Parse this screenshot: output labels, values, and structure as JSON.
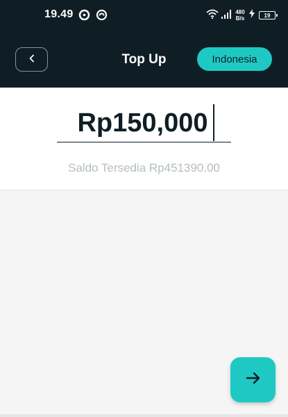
{
  "status_bar": {
    "time": "19.49",
    "network_speed_value": "480",
    "network_speed_unit": "B/s",
    "battery_level": "19"
  },
  "header": {
    "title": "Top Up",
    "country_label": "Indonesia"
  },
  "amount": {
    "value": "Rp150,000",
    "balance_text": "Saldo Tersedia Rp451390.00"
  },
  "icons": {
    "back": "chevron-left-icon",
    "next": "arrow-right-icon"
  },
  "colors": {
    "header_bg": "#0f1e25",
    "accent": "#1fc9c3",
    "balance_text": "#b4bdc2",
    "page_bg": "#f5f5f5"
  }
}
